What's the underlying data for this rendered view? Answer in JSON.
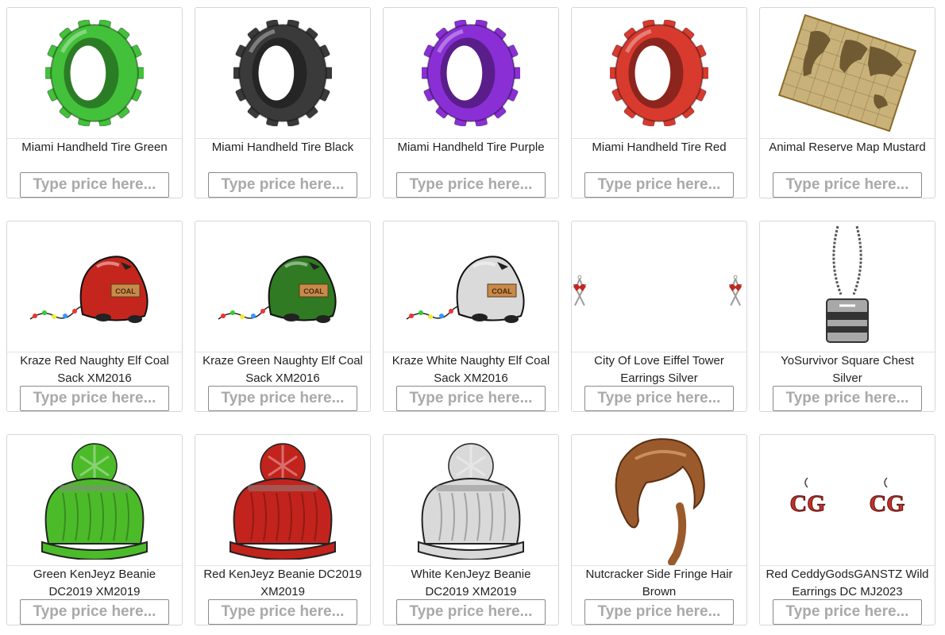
{
  "placeholder": "Type price here...",
  "items": [
    {
      "name": "Miami Handheld Tire Green",
      "icon": "tire-icon",
      "color": "#43c13a"
    },
    {
      "name": "Miami Handheld Tire Black",
      "icon": "tire-icon",
      "color": "#3a3a3a"
    },
    {
      "name": "Miami Handheld Tire Purple",
      "icon": "tire-icon",
      "color": "#8a2fd6"
    },
    {
      "name": "Miami Handheld Tire Red",
      "icon": "tire-icon",
      "color": "#d83a2e"
    },
    {
      "name": "Animal Reserve Map Mustard",
      "icon": "map-icon",
      "color": "#c9b27a"
    },
    {
      "name": "Kraze Red Naughty Elf Coal Sack XM2016",
      "icon": "coal-sack-icon",
      "color": "#c4261d"
    },
    {
      "name": "Kraze Green Naughty Elf Coal Sack XM2016",
      "icon": "coal-sack-icon",
      "color": "#2f7a22"
    },
    {
      "name": "Kraze White Naughty Elf Coal Sack XM2016",
      "icon": "coal-sack-icon",
      "color": "#dadada"
    },
    {
      "name": "City Of Love Eiffel Tower Earrings Silver",
      "icon": "eiffel-earrings-icon",
      "color": "#9a9a9a"
    },
    {
      "name": "YoSurvivor Square Chest Silver",
      "icon": "chest-pendant-icon",
      "color": "#a8a8a8"
    },
    {
      "name": "Green KenJeyz Beanie DC2019 XM2019",
      "icon": "beanie-icon",
      "color": "#4cbb2a"
    },
    {
      "name": "Red KenJeyz Beanie DC2019 XM2019",
      "icon": "beanie-icon",
      "color": "#c2231c"
    },
    {
      "name": "White KenJeyz Beanie DC2019 XM2019",
      "icon": "beanie-icon",
      "color": "#d9d9d9"
    },
    {
      "name": "Nutcracker Side Fringe Hair Brown",
      "icon": "hair-icon",
      "color": "#9a5a2c"
    },
    {
      "name": "Red CeddyGodsGANSTZ Wild Earrings DC MJ2023",
      "icon": "cg-earrings-icon",
      "color": "#c2302a"
    }
  ]
}
